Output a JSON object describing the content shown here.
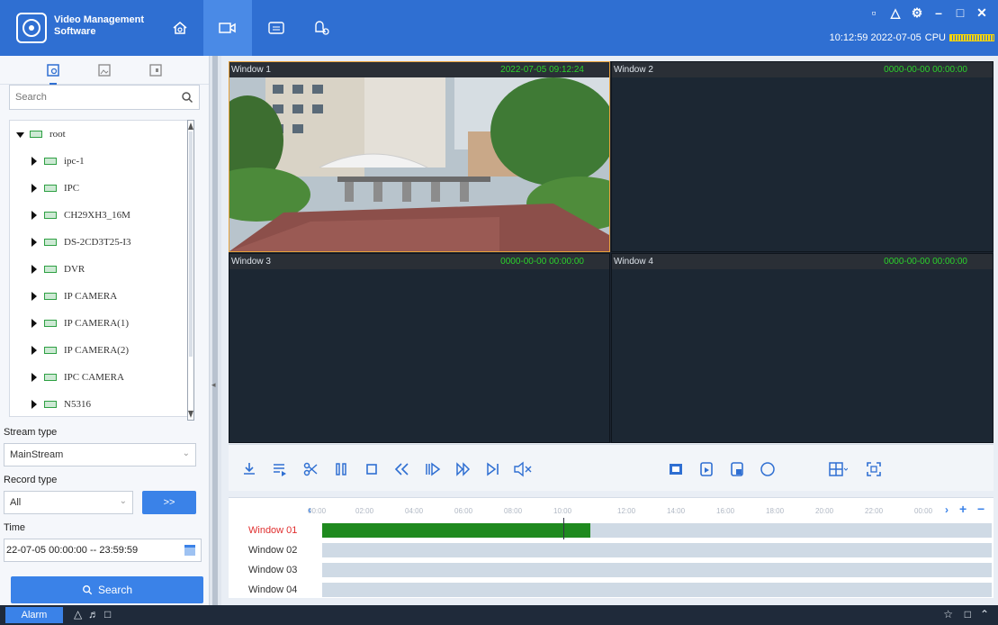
{
  "app": {
    "title": "Video Management Software"
  },
  "status": {
    "time": "10:12:59 2022-07-05",
    "cpu_label": "CPU"
  },
  "sidebar": {
    "search_placeholder": "Search",
    "tree": [
      {
        "label": "root"
      },
      {
        "label": "ipc-1"
      },
      {
        "label": "IPC"
      },
      {
        "label": "CH29XH3_16M"
      },
      {
        "label": "DS-2CD3T25-I3"
      },
      {
        "label": "DVR"
      },
      {
        "label": "IP CAMERA"
      },
      {
        "label": "IP CAMERA(1)"
      },
      {
        "label": "IP CAMERA(2)"
      },
      {
        "label": "IPC CAMERA"
      },
      {
        "label": "N5316"
      }
    ],
    "stream_type_label": "Stream type",
    "stream_type_value": "MainStream",
    "record_type_label": "Record type",
    "record_type_value": "All",
    "go_label": ">>",
    "time_label": "Time",
    "time_value": "22-07-05 00:00:00 -- 23:59:59",
    "search_button": "Search"
  },
  "windows": [
    {
      "title": "Window 1",
      "timestamp": "2022-07-05 09:12:24"
    },
    {
      "title": "Window 2",
      "timestamp": "0000-00-00 00:00:00"
    },
    {
      "title": "Window 3",
      "timestamp": "0000-00-00 00:00:00"
    },
    {
      "title": "Window 4",
      "timestamp": "0000-00-00 00:00:00"
    }
  ],
  "timeline": {
    "ticks": [
      "00:00",
      "02:00",
      "04:00",
      "06:00",
      "08:00",
      "10:00",
      "12:00",
      "14:00",
      "16:00",
      "18:00",
      "20:00",
      "22:00",
      "00:00"
    ],
    "plus": "+",
    "minus": "−",
    "tracks": [
      {
        "label": "Window 01",
        "recording": [
          0,
          0.4
        ]
      },
      {
        "label": "Window 02"
      },
      {
        "label": "Window 03"
      },
      {
        "label": "Window 04"
      }
    ]
  },
  "bottom": {
    "alarm_label": "Alarm"
  },
  "colors": {
    "accent": "#2f6fd2",
    "recording": "#1f8a1f",
    "timestamp": "#2bd22b"
  }
}
